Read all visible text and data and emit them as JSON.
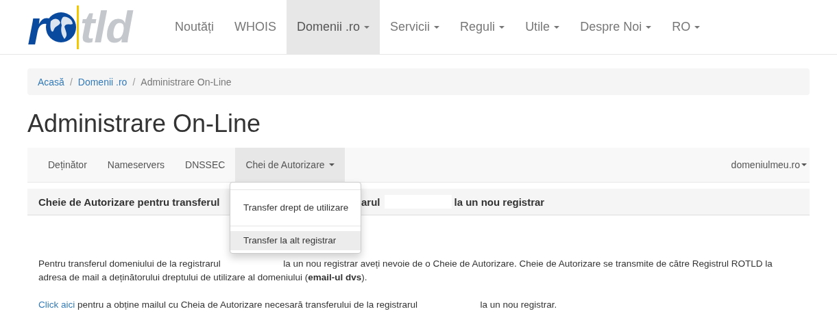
{
  "logo": {
    "left": "r",
    "right": "tld"
  },
  "navbar": {
    "items": [
      {
        "label": "Noutăți",
        "caret": false,
        "selected": false
      },
      {
        "label": "WHOIS",
        "caret": false,
        "selected": false
      },
      {
        "label": "Domenii .ro",
        "caret": true,
        "selected": true
      },
      {
        "label": "Servicii",
        "caret": true,
        "selected": false
      },
      {
        "label": "Reguli",
        "caret": true,
        "selected": false
      },
      {
        "label": "Utile",
        "caret": true,
        "selected": false
      },
      {
        "label": "Despre Noi",
        "caret": true,
        "selected": false
      },
      {
        "label": "RO",
        "caret": true,
        "selected": false
      }
    ]
  },
  "breadcrumb": {
    "separator": "/",
    "items": [
      {
        "label": "Acasă",
        "link": true
      },
      {
        "label": "Domenii .ro",
        "link": true
      },
      {
        "label": "Administrare On-Line",
        "link": false
      }
    ]
  },
  "page_title": "Administrare On-Line",
  "subnav": {
    "tabs": [
      {
        "label": "Deținător",
        "caret": false,
        "selected": false
      },
      {
        "label": "Nameservers",
        "caret": false,
        "selected": false
      },
      {
        "label": "DNSSEC",
        "caret": false,
        "selected": false
      },
      {
        "label": "Chei de Autorizare",
        "caret": true,
        "selected": true
      }
    ],
    "domain": {
      "label": "domeniulmeu.ro",
      "caret": true
    },
    "dropdown": {
      "items": [
        {
          "label": "Transfer drept de utilizare",
          "highlighted": false
        },
        {
          "label": "Transfer la alt registrar",
          "highlighted": true
        }
      ]
    }
  },
  "panel_heading": {
    "left": "Cheie de Autorizare pentru transferul",
    "middle": "arul",
    "right": "la un nou registrar"
  },
  "paragraphs": [
    {
      "before": "Pentru transferul domeniului de la registrarul",
      "after": "la un nou registrar aveți nevoie de o Cheie de Autorizare. Cheie de Autorizare se transmite de către Registrul ROTLD la adresa de mail a deținătorului dreptului de utilizare al domeniului (**email-ul dvs**)."
    },
    {
      "link": "Click aici",
      "before": "pentru a obține mailul cu Cheia de Autorizare necesară transferului de la registrarul",
      "after": "la un nou registrar."
    }
  ]
}
